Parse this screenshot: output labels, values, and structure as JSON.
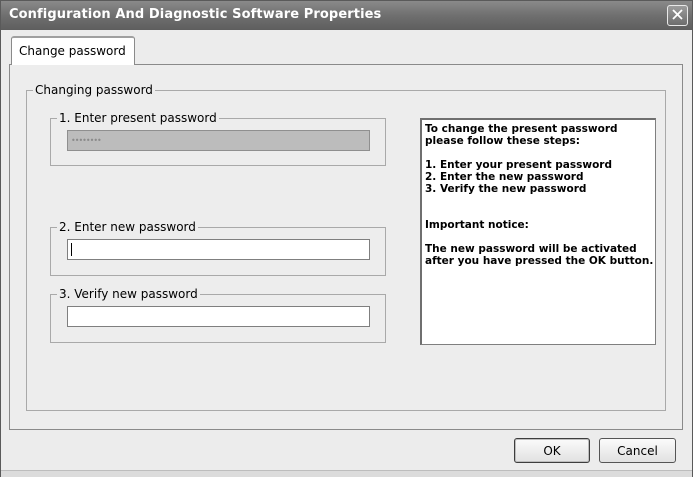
{
  "window": {
    "title": "Configuration And Diagnostic Software  Properties",
    "close_icon": "close-icon"
  },
  "tabs": [
    {
      "label": "Change password",
      "selected": true
    }
  ],
  "groups": {
    "outer": "Changing password",
    "present": "1. Enter present password",
    "new": "2. Enter new password",
    "verify": "3. Verify new password"
  },
  "fields": {
    "present_value": "••••••••",
    "new_value": "",
    "verify_value": ""
  },
  "help": {
    "intro_line1": "To change the present password",
    "intro_line2": "please follow these steps:",
    "step1": "1. Enter your present password",
    "step2": "2. Enter the new password",
    "step3": "3. Verify the new password",
    "notice_title": "Important notice:",
    "notice_line1": "The new password will be activated",
    "notice_line2": "after you have pressed the OK button."
  },
  "buttons": {
    "ok": "OK",
    "cancel": "Cancel"
  }
}
